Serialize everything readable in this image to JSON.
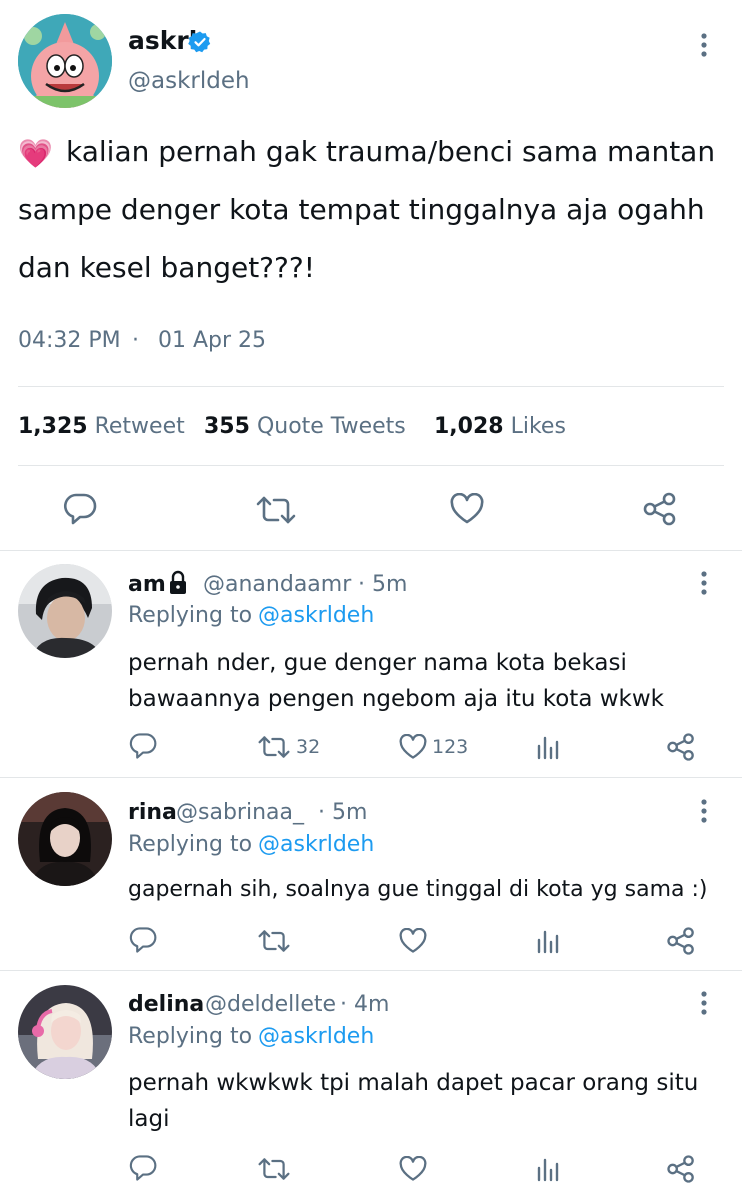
{
  "tweet": {
    "author_name": "askrl",
    "author_handle": "@askrldeh",
    "emoji": "💗",
    "text_line1": "kalian pernah gak trauma/benci sama mantan",
    "text_line2": "sampe denger kota tempat tinggalnya aja ogahh",
    "text_line3": "dan kesel banget???!",
    "time": "04:32 PM",
    "dot": "·",
    "date": "01 Apr 25",
    "stats": {
      "retweets_count": "1,325",
      "retweets_label": "Retweet",
      "quotes_count": "355",
      "quotes_label": "Quote Tweets",
      "likes_count": "1,028",
      "likes_label": "Likes"
    }
  },
  "replies": [
    {
      "name": "am",
      "handle": "@anandaamr",
      "time": "· 5m",
      "replying_label": "Replying to",
      "replying_to": "@askrldeh",
      "text_line1": "pernah nder, gue denger nama kota bekasi",
      "text_line2": "bawaannya pengen ngebom aja itu kota wkwk",
      "retweet_count": "32",
      "like_count": "123"
    },
    {
      "name": "rina",
      "handle": "@sabrinaa_",
      "time": "· 5m",
      "replying_label": "Replying to",
      "replying_to": "@askrldeh",
      "text_line1": "gapernah sih, soalnya gue tinggal di kota yg sama :)"
    },
    {
      "name": "delina",
      "handle": "@deldellete",
      "time": "· 4m",
      "replying_label": "Replying to",
      "replying_to": "@askrldeh",
      "text_line1": "pernah wkwkwk tpi malah dapet pacar orang situ",
      "text_line2": "lagi"
    }
  ],
  "colors": {
    "accent": "#1d9bf0",
    "muted": "#5b7083",
    "text": "#0f1419",
    "divider": "#e3e6e8"
  },
  "icons": [
    "verified-badge-icon",
    "more-options-icon",
    "reply-icon",
    "retweet-icon",
    "like-icon",
    "share-icon",
    "analytics-icon",
    "lock-icon"
  ]
}
